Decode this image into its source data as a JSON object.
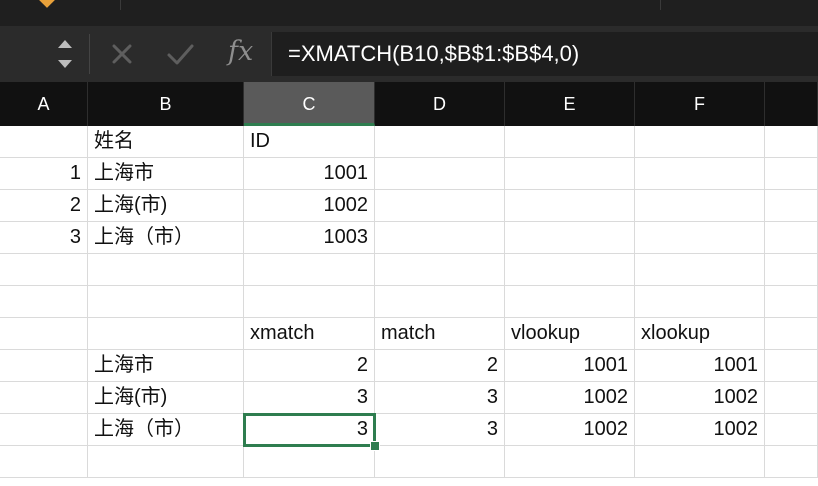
{
  "formula_bar": {
    "fx_label": "fx",
    "formula": "=XMATCH(B10,$B$1:$B$4,0)"
  },
  "columns": [
    "A",
    "B",
    "C",
    "D",
    "E",
    "F"
  ],
  "active_column": "C",
  "rows": [
    [
      "",
      "姓名",
      "ID",
      "",
      "",
      ""
    ],
    [
      "1",
      "上海市",
      "1001",
      "",
      "",
      ""
    ],
    [
      "2",
      "上海(市)",
      "1002",
      "",
      "",
      ""
    ],
    [
      "3",
      "上海（市）",
      "1003",
      "",
      "",
      ""
    ],
    [
      "",
      "",
      "",
      "",
      "",
      ""
    ],
    [
      "",
      "",
      "",
      "",
      "",
      ""
    ],
    [
      "",
      "",
      "xmatch",
      "match",
      "vlookup",
      "xlookup"
    ],
    [
      "",
      "上海市",
      "2",
      "2",
      "1001",
      "1001"
    ],
    [
      "",
      "上海(市)",
      "3",
      "3",
      "1002",
      "1002"
    ],
    [
      "",
      "上海（市）",
      "3",
      "3",
      "1002",
      "1002"
    ],
    [
      "",
      "",
      "",
      "",
      "",
      ""
    ]
  ],
  "colors": {
    "selection": "#2e7d4f",
    "header_bg": "#111111",
    "formula_bg": "#2b2b2b"
  }
}
